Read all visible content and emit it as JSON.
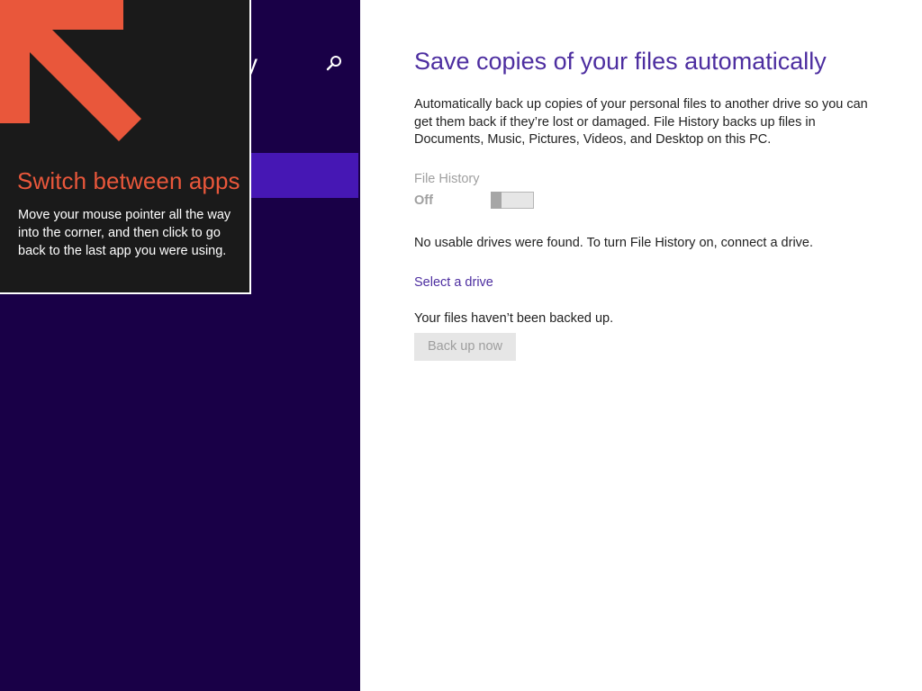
{
  "left_pane": {
    "title_fragment": "y",
    "search_icon": "search-icon",
    "background_color": "#190047",
    "selected_color": "#4617b4"
  },
  "tip": {
    "title": "Switch between apps",
    "body": "Move your mouse pointer all the way into the corner, and then click to go back to the last app you were using.",
    "arrow_icon": "arrow-up-left-icon",
    "accent_color": "#e9573b"
  },
  "main": {
    "title": "Save copies of your files automatically",
    "description": "Automatically back up copies of your personal files to another drive so you can get them back if they’re lost or damaged. File History backs up files in Documents, Music, Pictures, Videos, and Desktop on this PC.",
    "file_history": {
      "label": "File History",
      "state": "Off",
      "enabled": false
    },
    "no_drives_message": "No usable drives were found. To turn File History on, connect a drive.",
    "select_drive_link": "Select a drive",
    "backup_status": "Your files haven’t been backed up.",
    "backup_button": "Back up now",
    "accent_color": "#4d2ea0"
  }
}
